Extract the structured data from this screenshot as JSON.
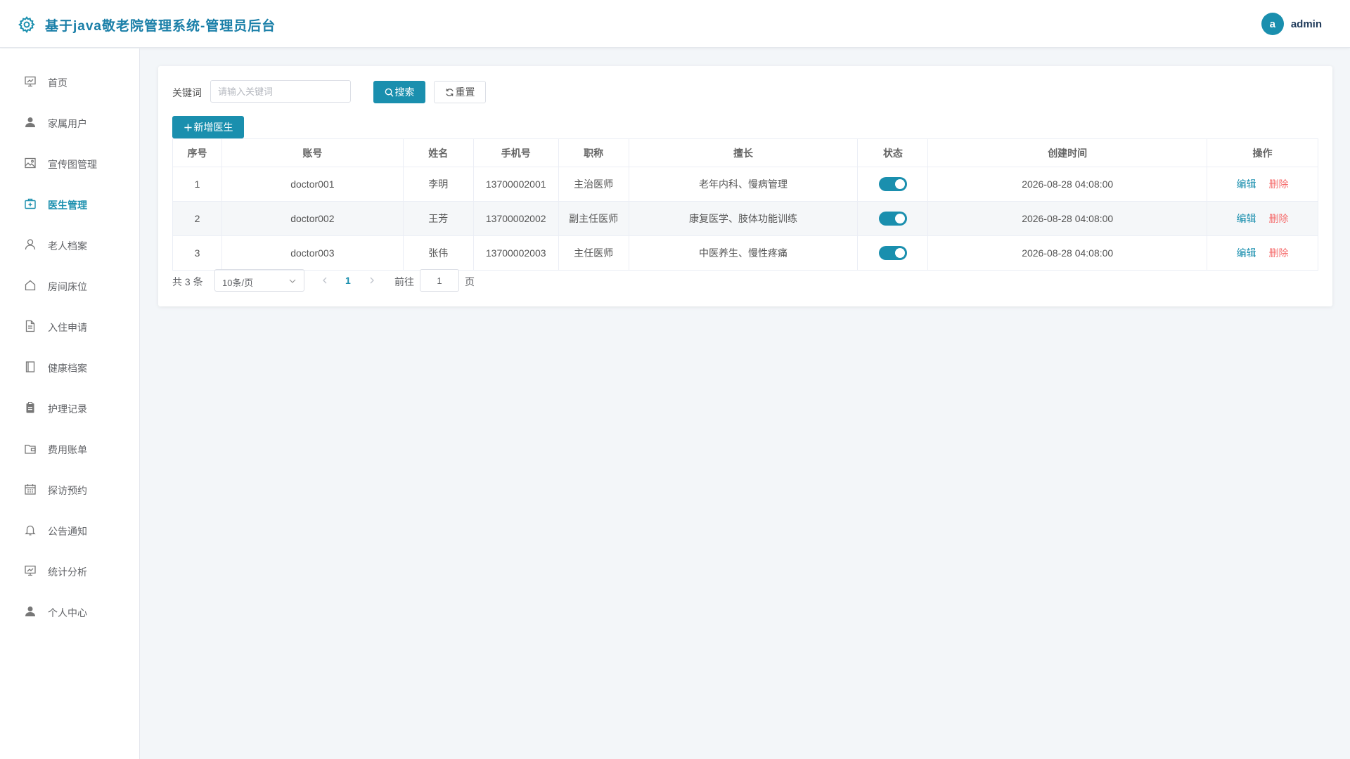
{
  "header": {
    "title": "基于java敬老院管理系统-管理员后台",
    "avatar_letter": "a",
    "username": "admin"
  },
  "sidebar": {
    "items": [
      {
        "label": "首页",
        "icon": "dashboard-icon",
        "active": false
      },
      {
        "label": "家属用户",
        "icon": "user-icon",
        "active": false
      },
      {
        "label": "宣传图管理",
        "icon": "image-icon",
        "active": false
      },
      {
        "label": "医生管理",
        "icon": "medical-box-icon",
        "active": true
      },
      {
        "label": "老人档案",
        "icon": "person-outline-icon",
        "active": false
      },
      {
        "label": "房间床位",
        "icon": "house-icon",
        "active": false
      },
      {
        "label": "入住申请",
        "icon": "document-icon",
        "active": false
      },
      {
        "label": "健康档案",
        "icon": "notebook-icon",
        "active": false
      },
      {
        "label": "护理记录",
        "icon": "clipboard-icon",
        "active": false
      },
      {
        "label": "费用账单",
        "icon": "wallet-icon",
        "active": false
      },
      {
        "label": "探访预约",
        "icon": "calendar-icon",
        "active": false
      },
      {
        "label": "公告通知",
        "icon": "bell-icon",
        "active": false
      },
      {
        "label": "统计分析",
        "icon": "presentation-chart-icon",
        "active": false
      },
      {
        "label": "个人中心",
        "icon": "user-icon",
        "active": false
      }
    ]
  },
  "search": {
    "label": "关键词",
    "placeholder": "请输入关键词",
    "search_button": "搜索",
    "reset_button": "重置",
    "add_button": "新增医生"
  },
  "table": {
    "columns": [
      "序号",
      "账号",
      "姓名",
      "手机号",
      "职称",
      "擅长",
      "状态",
      "创建时间",
      "操作"
    ],
    "rows": [
      {
        "index": "1",
        "account": "doctor001",
        "name": "李明",
        "phone": "13700002001",
        "title": "主治医师",
        "specialty": "老年内科、慢病管理",
        "status_on": true,
        "created": "2026-08-28 04:08:00"
      },
      {
        "index": "2",
        "account": "doctor002",
        "name": "王芳",
        "phone": "13700002002",
        "title": "副主任医师",
        "specialty": "康复医学、肢体功能训练",
        "status_on": true,
        "created": "2026-08-28 04:08:00"
      },
      {
        "index": "3",
        "account": "doctor003",
        "name": "张伟",
        "phone": "13700002003",
        "title": "主任医师",
        "specialty": "中医养生、慢性疼痛",
        "status_on": true,
        "created": "2026-08-28 04:08:00"
      }
    ],
    "edit_label": "编辑",
    "delete_label": "删除"
  },
  "pagination": {
    "total_text": "共 3 条",
    "page_size": "10条/页",
    "current_page": "1",
    "goto_label": "前往",
    "goto_value": "1",
    "page_suffix": "页"
  },
  "colors": {
    "primary": "#1a8fae",
    "danger": "#f56c6c",
    "background": "#f3f6f9"
  }
}
